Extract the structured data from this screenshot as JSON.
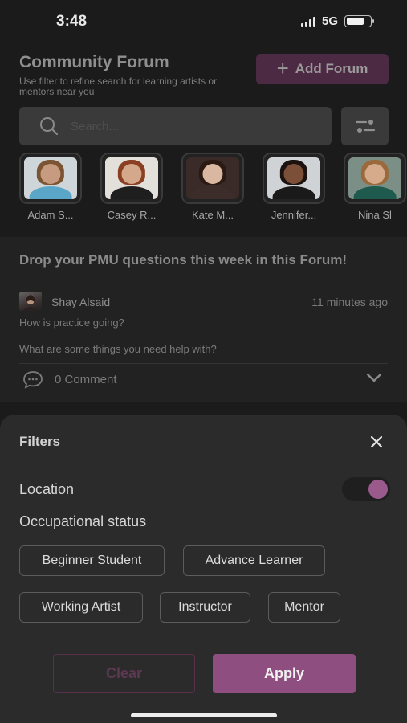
{
  "status_bar": {
    "time": "3:48",
    "network": "5G",
    "battery_level": 0.75
  },
  "header": {
    "title": "Community Forum",
    "subtitle": "Use filter to refine search for learning artists or mentors near you",
    "add_button_label": "Add Forum",
    "add_icon": "plus-icon"
  },
  "search": {
    "placeholder": "Search...",
    "value": ""
  },
  "mentors": [
    {
      "name": "Adam S...",
      "colors": {
        "bg": "#cfd6da",
        "skin": "#c79b7f",
        "hair": "#7a5433",
        "shirt": "#5aa6c8"
      }
    },
    {
      "name": "Casey R...",
      "colors": {
        "bg": "#e3e0db",
        "skin": "#d4a88b",
        "hair": "#8a3e22",
        "shirt": "#1e1e1e"
      }
    },
    {
      "name": "Kate M...",
      "colors": {
        "bg": "#3a2a28",
        "skin": "#d9b7a1",
        "hair": "#2b1a14",
        "shirt": "#3c2c2a"
      }
    },
    {
      "name": "Jennifer...",
      "colors": {
        "bg": "#cfd3d6",
        "skin": "#7c5038",
        "hair": "#1c1310",
        "shirt": "#1a1a1a"
      }
    },
    {
      "name": "Nina Sl",
      "colors": {
        "bg": "#7b8f86",
        "skin": "#d5ab8c",
        "hair": "#9a6a3c",
        "shirt": "#1f5a4e"
      }
    }
  ],
  "post": {
    "title": "Drop your PMU questions this week in this Forum!",
    "author": "Shay Alsaid",
    "time": "11 minutes ago",
    "line1": "How is practice going?",
    "line2": "What are some things you need help with?",
    "comment_count_label": "0 Comment"
  },
  "filters": {
    "title": "Filters",
    "location_label": "Location",
    "location_enabled": true,
    "occupational_label": "Occupational status",
    "chips": [
      "Beginner Student",
      "Advance Learner",
      "Working Artist",
      "Instructor",
      "Mentor"
    ],
    "clear_label": "Clear",
    "apply_label": "Apply"
  },
  "colors": {
    "accent": "#8e4e7f",
    "accent_dark": "#4d2a43",
    "sheet_bg": "#2b2b2b"
  }
}
